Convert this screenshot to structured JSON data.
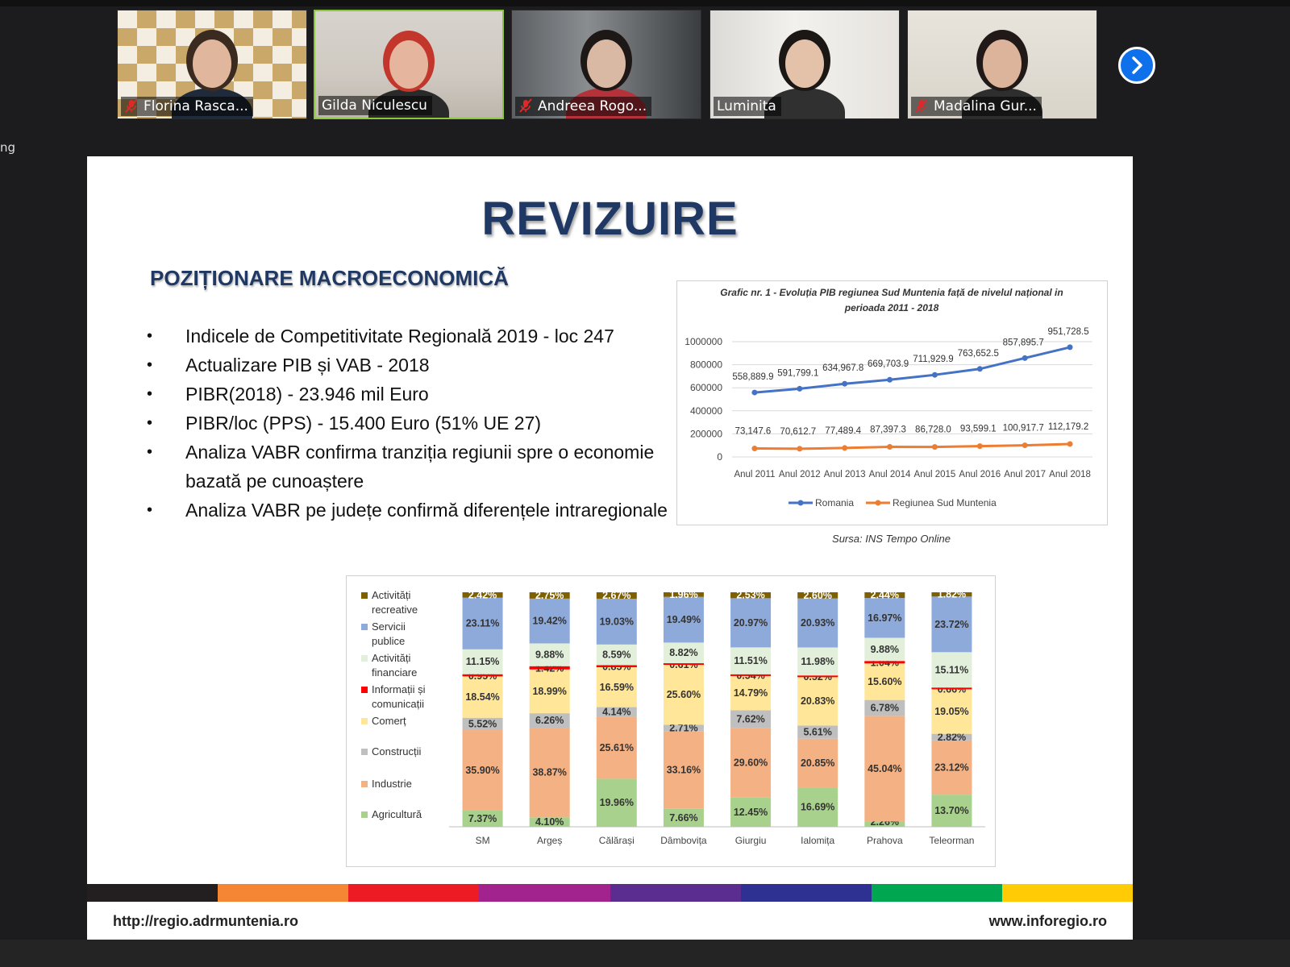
{
  "participants": [
    {
      "name": "Florina Rasca...",
      "muted": true,
      "active": false
    },
    {
      "name": "Gilda Niculescu",
      "muted": false,
      "active": true
    },
    {
      "name": "Andreea Rogo...",
      "muted": true,
      "active": false
    },
    {
      "name": "Luminita",
      "muted": false,
      "active": false
    },
    {
      "name": "Madalina Gur...",
      "muted": true,
      "active": false
    }
  ],
  "left_cut_text": "ng",
  "slide": {
    "title": "REVIZUIRE",
    "subtitle": "POZIȚIONARE MACROECONOMICĂ",
    "bullets": [
      "Indicele de Competitivitate Regională 2019 - loc 247",
      "Actualizare PIB și VAB - 2018",
      "PIBR(2018) - 23.946 mil Euro",
      "PIBR/loc (PPS) - 15.400 Euro (51% UE 27)",
      "Analiza VABR confirma tranziția regiunii spre o economie bazată pe cunoaștere",
      "Analiza VABR pe județe confirmă diferențele intraregionale"
    ],
    "line_source": "Sursa: INS Tempo Online",
    "footer_left": "http://regio.adrmuntenia.ro",
    "footer_right": "www.inforegio.ro",
    "band_colors": [
      "#231f20",
      "#f58634",
      "#ed1c24",
      "#a3238e",
      "#5b2d90",
      "#2e3192",
      "#00a650",
      "#ffcb05"
    ]
  },
  "chart_data": [
    {
      "type": "line",
      "title": "Grafic nr.  1 - Evoluția PIB regiunea Sud Muntenia față de nivelul național in perioada 2011 - 2018",
      "categories": [
        "Anul 2011",
        "Anul 2012",
        "Anul 2013",
        "Anul 2014",
        "Anul 2015",
        "Anul 2016",
        "Anul 2017",
        "Anul 2018"
      ],
      "ylim": [
        0,
        1000000
      ],
      "yticks": [
        "0",
        "200000",
        "400000",
        "600000",
        "800000",
        "1000000"
      ],
      "series": [
        {
          "name": "Romania",
          "color": "#4472c4",
          "values": [
            558889.9,
            591799.1,
            634967.8,
            669703.9,
            711929.9,
            763652.5,
            857895.7,
            951728.5
          ],
          "labels": [
            "558,889.9",
            "591,799.1",
            "634,967.8",
            "669,703.9",
            "711,929.9",
            "763,652.5",
            "857,895.7",
            "951,728.5"
          ]
        },
        {
          "name": "Regiunea Sud Muntenia",
          "color": "#ed7d31",
          "values": [
            73147.6,
            70612.7,
            77489.4,
            87397.3,
            86728.0,
            93599.1,
            100917.7,
            112179.2
          ],
          "labels": [
            "73,147.6",
            "70,612.7",
            "77,489.4",
            "87,397.3",
            "86,728.0",
            "93,599.1",
            "100,917.7",
            "112,179.2"
          ]
        }
      ],
      "grid": true,
      "legend": "bottom"
    },
    {
      "type": "bar",
      "stacked": "percent",
      "categories": [
        "SM",
        "Argeș",
        "Călărași",
        "Dâmbovița",
        "Giurgiu",
        "Ialomița",
        "Prahova",
        "Teleorman"
      ],
      "series": [
        {
          "name": "Agricultură",
          "color": "#a9d18e",
          "values": [
            7.37,
            4.1,
            19.96,
            7.66,
            12.45,
            16.69,
            2.26,
            13.7
          ],
          "labels": [
            "7.37%",
            "4.10%",
            "19.96%",
            "7.66%",
            "12.45%",
            "16.69%",
            "2.26%",
            "13.70%"
          ]
        },
        {
          "name": "Industrie",
          "color": "#f4b183",
          "values": [
            35.9,
            38.87,
            25.61,
            33.16,
            29.6,
            20.85,
            45.04,
            23.12
          ],
          "labels": [
            "35.90%",
            "38.87%",
            "25.61%",
            "33.16%",
            "29.60%",
            "20.85%",
            "45.04%",
            "23.12%"
          ]
        },
        {
          "name": "Construcții",
          "color": "#bfbfbf",
          "values": [
            5.52,
            6.26,
            4.14,
            2.71,
            7.62,
            5.61,
            6.78,
            2.82
          ],
          "labels": [
            "5.52%",
            "6.26%",
            "4.14%",
            "2.71%",
            "7.62%",
            "5.61%",
            "6.78%",
            "2.82%"
          ]
        },
        {
          "name": "Comerț",
          "color": "#ffe699",
          "values": [
            18.54,
            18.99,
            16.59,
            25.6,
            14.79,
            20.83,
            15.6,
            19.05
          ],
          "labels": [
            "18.54%",
            "18.99%",
            "16.59%",
            "25.60%",
            "14.79%",
            "20.83%",
            "15.60%",
            "19.05%"
          ]
        },
        {
          "name": "Informații și comunicații",
          "color": "#ff0000",
          "values": [
            0.95,
            1.42,
            0.85,
            0.61,
            0.54,
            0.52,
            1.04,
            0.66
          ],
          "labels": [
            "0.95%",
            "1.42%",
            "0.85%",
            "0.61%",
            "0.54%",
            "0.52%",
            "1.04%",
            "0.66%"
          ]
        },
        {
          "name": "Activități financiare",
          "color": "#e2efda",
          "values": [
            11.15,
            9.88,
            8.59,
            8.82,
            11.51,
            11.98,
            9.88,
            15.11
          ],
          "labels": [
            "11.15%",
            "9.88%",
            "8.59%",
            "8.82%",
            "11.51%",
            "11.98%",
            "9.88%",
            "15.11%"
          ]
        },
        {
          "name": "Servicii publice",
          "color": "#8eaadb",
          "values": [
            23.11,
            19.42,
            19.03,
            19.49,
            20.97,
            20.93,
            16.97,
            23.72
          ],
          "labels": [
            "23.11%",
            "19.42%",
            "19.03%",
            "19.49%",
            "20.97%",
            "20.93%",
            "16.97%",
            "23.72%"
          ]
        },
        {
          "name": "Activități recreative",
          "color": "#7f6000",
          "values": [
            2.42,
            2.75,
            2.67,
            1.96,
            2.53,
            2.6,
            2.44,
            1.82
          ],
          "labels": [
            "2.42%",
            "2.75%",
            "2.67%",
            "1.96%",
            "2.53%",
            "2.60%",
            "2.44%",
            "1.82%"
          ]
        }
      ],
      "legend": "left"
    }
  ]
}
